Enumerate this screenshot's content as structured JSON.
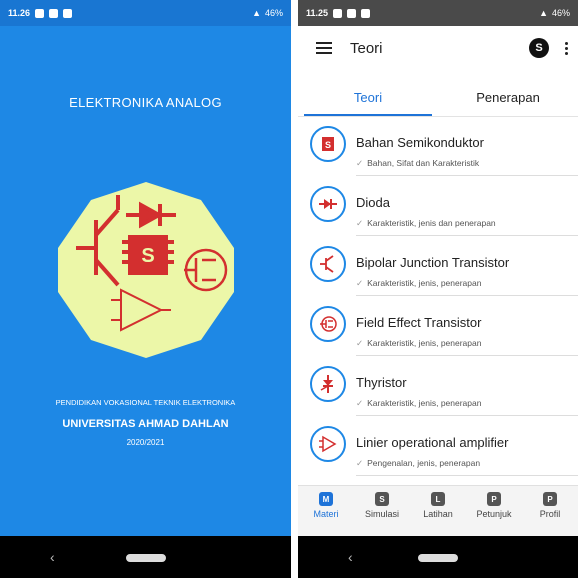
{
  "left": {
    "status": {
      "time": "11.26",
      "battery": "46%"
    },
    "title": "ELEKTRONIKA ANALOG",
    "logo_letter": "S",
    "footer": {
      "program": "PENDIDIKAN VOKASIONAL TEKNIK ELEKTRONIKA",
      "university": "UNIVERSITAS AHMAD DAHLAN",
      "year": "2020/2021"
    }
  },
  "right": {
    "status": {
      "time": "11.25",
      "battery": "46%"
    },
    "appbar": {
      "title": "Teori",
      "avatar_letter": "S"
    },
    "tabs": [
      {
        "label": "Teori"
      },
      {
        "label": "Penerapan"
      }
    ],
    "items": [
      {
        "title": "Bahan Semikonduktor",
        "subtitle": "Bahan, Sifat dan Karakteristik",
        "icon": "chip-icon"
      },
      {
        "title": "Dioda",
        "subtitle": "Karakteristik, jenis dan penerapan",
        "icon": "diode-icon"
      },
      {
        "title": "Bipolar Junction Transistor",
        "subtitle": "Karakteristik, jenis, penerapan",
        "icon": "bjt-icon"
      },
      {
        "title": "Field Effect Transistor",
        "subtitle": "Karakteristik, jenis, penerapan",
        "icon": "fet-icon"
      },
      {
        "title": "Thyristor",
        "subtitle": "Karakteristik, jenis, penerapan",
        "icon": "thyristor-icon"
      },
      {
        "title": "Linier operational amplifier",
        "subtitle": "Pengenalan, jenis, penerapan",
        "icon": "opamp-icon"
      }
    ],
    "bottom_nav": [
      {
        "label": "Materi",
        "letter": "M"
      },
      {
        "label": "Simulasi",
        "letter": "S"
      },
      {
        "label": "Latihan",
        "letter": "L"
      },
      {
        "label": "Petunjuk",
        "letter": "P"
      },
      {
        "label": "Profil",
        "letter": "P"
      }
    ]
  },
  "colors": {
    "primary": "#1e88e5",
    "accent": "#d32f2f",
    "logo_bg": "#ecf7a8"
  }
}
